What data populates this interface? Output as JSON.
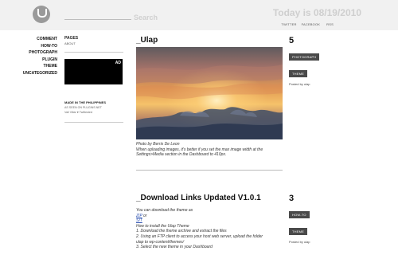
{
  "header": {
    "search_placeholder": "Search",
    "today_label": "Today is 08/19/2010",
    "links": [
      "TWITTER",
      "FACEBOOK",
      "RSS"
    ]
  },
  "nav": {
    "items": [
      "COMMENT",
      "HOW-TO",
      "PHOTOGRAPH",
      "PLUGIN",
      "THEME",
      "UNCATEGORIZED"
    ]
  },
  "sidebar": {
    "pages_title": "PAGES",
    "pages_items": [
      "ABOUT"
    ],
    "ad_label": "AD",
    "made_title": "MADE IN THE PHILIPPINES",
    "made_sub": "AS SEEN ON PLUGINS.NET",
    "made_meta": "Vali Villar ♥ Twittested"
  },
  "posts": [
    {
      "title": "_Ulap",
      "comment_count": "5",
      "tags": [
        "PHOTOGRAPH",
        "THEME"
      ],
      "posted_by": "Posted by ulap",
      "caption_line1": "Photo by Berris De Leon",
      "caption_line2": "When uploading images, it's better if you set the max image width at the",
      "caption_line3": "Settings>Media section in the Dashboard to 410px."
    },
    {
      "title": "_Download Links Updated V1.0.1",
      "comment_count": "3",
      "tags": [
        "HOW-TO",
        "THEME"
      ],
      "posted_by": "Posted by ulap",
      "lines": [
        "You can download the theme as",
        "ZIP",
        "or",
        "SIT",
        "How to install the Ulap Theme",
        "1. Download the theme archive and extract the files",
        "2. Using an FTP client to access your host web server, upload the folder",
        "ulap to wp-content/themes/",
        "3. Select the new theme in your Dashboard"
      ]
    }
  ],
  "colors": {
    "header_bg": "#f1f1f1",
    "badge_bg": "#4a4a4a",
    "link": "#2a4fb0"
  }
}
